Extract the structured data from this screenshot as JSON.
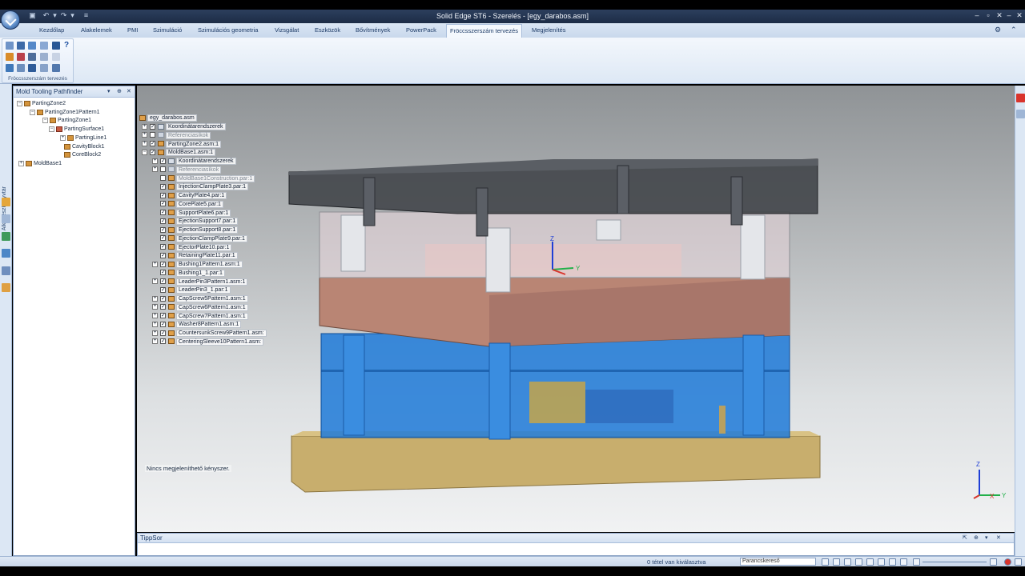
{
  "window": {
    "title": "Solid Edge ST6 - Szerelés - [egy_darabos.asm]"
  },
  "tabs": [
    {
      "label": "Kezdőlap"
    },
    {
      "label": "Alakelemek"
    },
    {
      "label": "PMI"
    },
    {
      "label": "Szimuláció"
    },
    {
      "label": "Szimulációs geometria"
    },
    {
      "label": "Vizsgálat"
    },
    {
      "label": "Eszközök"
    },
    {
      "label": "Bővítmények"
    },
    {
      "label": "PowerPack"
    },
    {
      "label": "Fröccsszerszám tervezés",
      "active": true
    },
    {
      "label": "Megjelenítés"
    }
  ],
  "ribbon": {
    "group_label": "Fröccsszerszám tervezés"
  },
  "left_strip": {
    "label": "Alkatrészkönyvtár"
  },
  "pathfinder": {
    "title": "Mold Tooling Pathfinder",
    "items": [
      {
        "label": "PartingZone2"
      },
      {
        "label": "PartingZone1Pattern1"
      },
      {
        "label": "PartingZone1"
      },
      {
        "label": "PartingSurface1"
      },
      {
        "label": "PartingLine1"
      },
      {
        "label": "CavityBlock1"
      },
      {
        "label": "CoreBlock2"
      },
      {
        "label": "MoldBase1"
      }
    ]
  },
  "assembly_tree": {
    "root": "egy_darabos.asm",
    "items": [
      {
        "label": "Koordinátarendszerek"
      },
      {
        "label": "Referenciasíkok"
      },
      {
        "label": "PartingZone2.asm:1"
      },
      {
        "label": "MoldBase1.asm:1"
      },
      {
        "label": "Koordinátarendszerek"
      },
      {
        "label": "Referenciasíkok"
      },
      {
        "label": "MoldBase1Construction.par:1"
      },
      {
        "label": "InjectionClampPlate3.par:1"
      },
      {
        "label": "CavityPlate4.par:1"
      },
      {
        "label": "CorePlate5.par:1"
      },
      {
        "label": "SupportPlate6.par:1"
      },
      {
        "label": "EjectionSupport7.par:1"
      },
      {
        "label": "EjectionSupport8.par:1"
      },
      {
        "label": "EjectionClampPlate9.par:1"
      },
      {
        "label": "EjectorPlate10.par:1"
      },
      {
        "label": "RetainingPlate11.par:1"
      },
      {
        "label": "Bushing1Pattern1.asm:1"
      },
      {
        "label": "Bushing1_1.par:1"
      },
      {
        "label": "LeaderPin3Pattern1.asm:1"
      },
      {
        "label": "LeaderPin3_1.par:1"
      },
      {
        "label": "CapScrew5Pattern1.asm:1"
      },
      {
        "label": "CapScrew6Pattern1.asm:1"
      },
      {
        "label": "CapScrew7Pattern1.asm:1"
      },
      {
        "label": "Washer8Pattern1.asm:1"
      },
      {
        "label": "CountersunkScrew9Pattern1.asm:"
      },
      {
        "label": "CenteringSleeve10Pattern1.asm:"
      }
    ]
  },
  "viewport": {
    "status_message": "Nincs megjeleníthető kényszer."
  },
  "triad": {
    "z": "Z",
    "y": "Y",
    "x": "X"
  },
  "tipsor": {
    "title": "TippSor"
  },
  "statusbar": {
    "selection": "0 tétel van kiválasztva",
    "command_search_placeholder": "Parancskereső"
  },
  "colors": {
    "top_plate": "#3c3f44",
    "brown_plate": "#b98574",
    "blue_plates": "#1f7ad8",
    "clamp_plate": "#c8ae6d"
  }
}
